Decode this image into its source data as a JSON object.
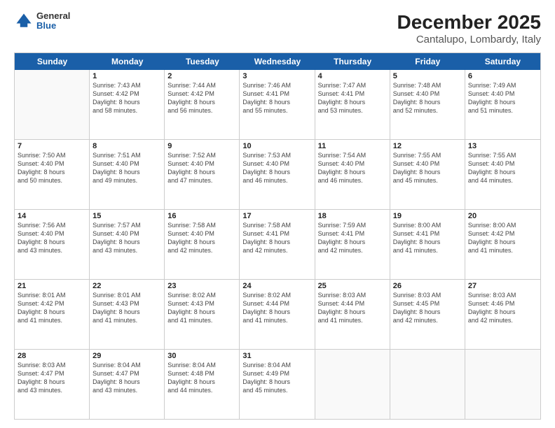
{
  "header": {
    "logo": {
      "general": "General",
      "blue": "Blue"
    },
    "title": "December 2025",
    "subtitle": "Cantalupo, Lombardy, Italy"
  },
  "calendar": {
    "days_of_week": [
      "Sunday",
      "Monday",
      "Tuesday",
      "Wednesday",
      "Thursday",
      "Friday",
      "Saturday"
    ],
    "rows": [
      [
        {
          "day": "",
          "info": ""
        },
        {
          "day": "1",
          "info": "Sunrise: 7:43 AM\nSunset: 4:42 PM\nDaylight: 8 hours\nand 58 minutes."
        },
        {
          "day": "2",
          "info": "Sunrise: 7:44 AM\nSunset: 4:42 PM\nDaylight: 8 hours\nand 56 minutes."
        },
        {
          "day": "3",
          "info": "Sunrise: 7:46 AM\nSunset: 4:41 PM\nDaylight: 8 hours\nand 55 minutes."
        },
        {
          "day": "4",
          "info": "Sunrise: 7:47 AM\nSunset: 4:41 PM\nDaylight: 8 hours\nand 53 minutes."
        },
        {
          "day": "5",
          "info": "Sunrise: 7:48 AM\nSunset: 4:40 PM\nDaylight: 8 hours\nand 52 minutes."
        },
        {
          "day": "6",
          "info": "Sunrise: 7:49 AM\nSunset: 4:40 PM\nDaylight: 8 hours\nand 51 minutes."
        }
      ],
      [
        {
          "day": "7",
          "info": "Sunrise: 7:50 AM\nSunset: 4:40 PM\nDaylight: 8 hours\nand 50 minutes."
        },
        {
          "day": "8",
          "info": "Sunrise: 7:51 AM\nSunset: 4:40 PM\nDaylight: 8 hours\nand 49 minutes."
        },
        {
          "day": "9",
          "info": "Sunrise: 7:52 AM\nSunset: 4:40 PM\nDaylight: 8 hours\nand 47 minutes."
        },
        {
          "day": "10",
          "info": "Sunrise: 7:53 AM\nSunset: 4:40 PM\nDaylight: 8 hours\nand 46 minutes."
        },
        {
          "day": "11",
          "info": "Sunrise: 7:54 AM\nSunset: 4:40 PM\nDaylight: 8 hours\nand 46 minutes."
        },
        {
          "day": "12",
          "info": "Sunrise: 7:55 AM\nSunset: 4:40 PM\nDaylight: 8 hours\nand 45 minutes."
        },
        {
          "day": "13",
          "info": "Sunrise: 7:55 AM\nSunset: 4:40 PM\nDaylight: 8 hours\nand 44 minutes."
        }
      ],
      [
        {
          "day": "14",
          "info": "Sunrise: 7:56 AM\nSunset: 4:40 PM\nDaylight: 8 hours\nand 43 minutes."
        },
        {
          "day": "15",
          "info": "Sunrise: 7:57 AM\nSunset: 4:40 PM\nDaylight: 8 hours\nand 43 minutes."
        },
        {
          "day": "16",
          "info": "Sunrise: 7:58 AM\nSunset: 4:40 PM\nDaylight: 8 hours\nand 42 minutes."
        },
        {
          "day": "17",
          "info": "Sunrise: 7:58 AM\nSunset: 4:41 PM\nDaylight: 8 hours\nand 42 minutes."
        },
        {
          "day": "18",
          "info": "Sunrise: 7:59 AM\nSunset: 4:41 PM\nDaylight: 8 hours\nand 42 minutes."
        },
        {
          "day": "19",
          "info": "Sunrise: 8:00 AM\nSunset: 4:41 PM\nDaylight: 8 hours\nand 41 minutes."
        },
        {
          "day": "20",
          "info": "Sunrise: 8:00 AM\nSunset: 4:42 PM\nDaylight: 8 hours\nand 41 minutes."
        }
      ],
      [
        {
          "day": "21",
          "info": "Sunrise: 8:01 AM\nSunset: 4:42 PM\nDaylight: 8 hours\nand 41 minutes."
        },
        {
          "day": "22",
          "info": "Sunrise: 8:01 AM\nSunset: 4:43 PM\nDaylight: 8 hours\nand 41 minutes."
        },
        {
          "day": "23",
          "info": "Sunrise: 8:02 AM\nSunset: 4:43 PM\nDaylight: 8 hours\nand 41 minutes."
        },
        {
          "day": "24",
          "info": "Sunrise: 8:02 AM\nSunset: 4:44 PM\nDaylight: 8 hours\nand 41 minutes."
        },
        {
          "day": "25",
          "info": "Sunrise: 8:03 AM\nSunset: 4:44 PM\nDaylight: 8 hours\nand 41 minutes."
        },
        {
          "day": "26",
          "info": "Sunrise: 8:03 AM\nSunset: 4:45 PM\nDaylight: 8 hours\nand 42 minutes."
        },
        {
          "day": "27",
          "info": "Sunrise: 8:03 AM\nSunset: 4:46 PM\nDaylight: 8 hours\nand 42 minutes."
        }
      ],
      [
        {
          "day": "28",
          "info": "Sunrise: 8:03 AM\nSunset: 4:47 PM\nDaylight: 8 hours\nand 43 minutes."
        },
        {
          "day": "29",
          "info": "Sunrise: 8:04 AM\nSunset: 4:47 PM\nDaylight: 8 hours\nand 43 minutes."
        },
        {
          "day": "30",
          "info": "Sunrise: 8:04 AM\nSunset: 4:48 PM\nDaylight: 8 hours\nand 44 minutes."
        },
        {
          "day": "31",
          "info": "Sunrise: 8:04 AM\nSunset: 4:49 PM\nDaylight: 8 hours\nand 45 minutes."
        },
        {
          "day": "",
          "info": ""
        },
        {
          "day": "",
          "info": ""
        },
        {
          "day": "",
          "info": ""
        }
      ]
    ]
  }
}
